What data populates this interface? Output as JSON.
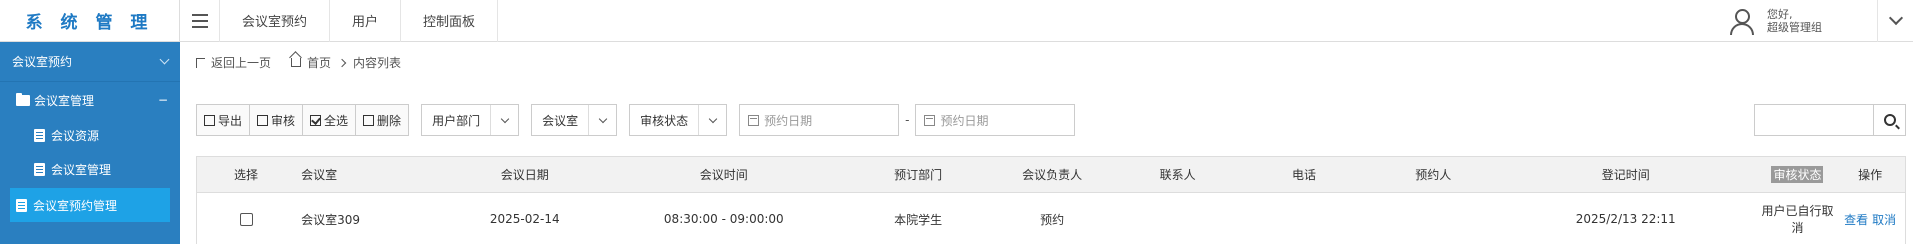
{
  "brand": "系 统 管 理",
  "sidebar": {
    "group_label": "会议室预约",
    "sub_label": "会议室管理",
    "sub_toggle": "−",
    "items": [
      {
        "label": "会议资源"
      },
      {
        "label": "会议室管理"
      },
      {
        "label": "会议室预约管理"
      }
    ]
  },
  "topnav": {
    "tabs": [
      {
        "label": "会议室预约"
      },
      {
        "label": "用户"
      },
      {
        "label": "控制面板"
      }
    ],
    "user_greeting": "您好,",
    "user_role": "超级管理组"
  },
  "breadcrumb": {
    "back": "返回上一页",
    "home": "首页",
    "current": "内容列表"
  },
  "toolbar": {
    "export": "导出",
    "audit": "审核",
    "select_all": "全选",
    "delete": "删除",
    "filter_dept": "用户部门",
    "filter_room": "会议室",
    "filter_status": "审核状态",
    "date_start_placeholder": "预约日期",
    "date_sep": "-",
    "date_end_placeholder": "预约日期"
  },
  "table": {
    "headers": [
      "选择",
      "会议室",
      "会议日期",
      "会议时间",
      "预订部门",
      "会议负责人",
      "联系人",
      "电话",
      "预约人",
      "登记时间",
      "审核状态",
      "操作"
    ],
    "rows": [
      {
        "room": "会议室309",
        "date": "2025-02-14",
        "time": "08:30:00 - 09:00:00",
        "dept": "本院学生",
        "owner": "预约",
        "contact": "",
        "phone": "",
        "booker": "",
        "registered": "2025/2/13 22:11",
        "status": "用户已自行取消",
        "action_view": "查看",
        "action_cancel": "取消"
      }
    ]
  }
}
